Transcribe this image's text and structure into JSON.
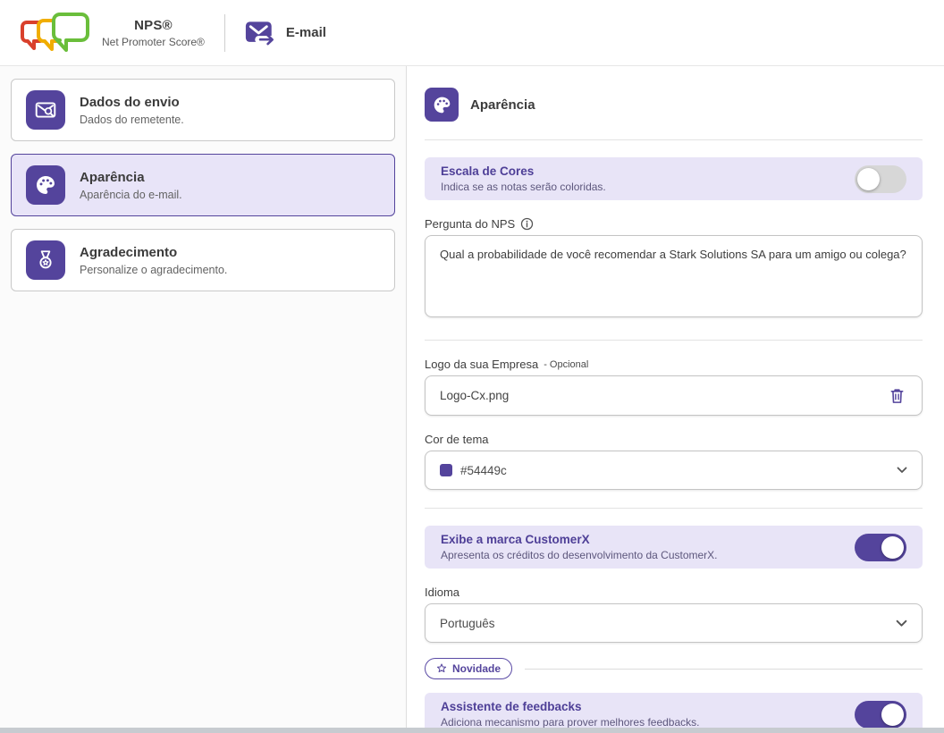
{
  "header": {
    "nps_title": "NPS®",
    "nps_subtitle": "Net Promoter Score®",
    "channel_label": "E-mail"
  },
  "sidebar": {
    "items": [
      {
        "title": "Dados do envio",
        "subtitle": "Dados do remetente.",
        "icon": "mail-search-icon",
        "active": false
      },
      {
        "title": "Aparência",
        "subtitle": "Aparência do e-mail.",
        "icon": "palette-icon",
        "active": true
      },
      {
        "title": "Agradecimento",
        "subtitle": "Personalize o agradecimento.",
        "icon": "medal-icon",
        "active": false
      }
    ]
  },
  "panel": {
    "title": "Aparência",
    "color_scale": {
      "title": "Escala de Cores",
      "subtitle": "Indica se as notas serão coloridas.",
      "enabled": false
    },
    "nps_question": {
      "label": "Pergunta do NPS",
      "value": "Qual a probabilidade de você recomendar a Stark Solutions SA para um amigo ou colega?"
    },
    "company_logo": {
      "label": "Logo da sua Empresa",
      "optional_label": "- Opcional",
      "value": "Logo-Cx.png"
    },
    "theme_color": {
      "label": "Cor de tema",
      "value": "#54449c",
      "swatch": "#54449c"
    },
    "brand": {
      "title": "Exibe a marca CustomerX",
      "subtitle": "Apresenta os créditos do desenvolvimento da CustomerX.",
      "enabled": true
    },
    "language": {
      "label": "Idioma",
      "value": "Português"
    },
    "novelty_badge": "Novidade",
    "assistant": {
      "title": "Assistente de feedbacks",
      "subtitle": "Adiciona mecanismo para prover melhores feedbacks.",
      "enabled": true
    }
  },
  "colors": {
    "primary": "#54449c",
    "row_background": "#e8e4f7",
    "logo_red": "#d9402c",
    "logo_yellow": "#f0ad00",
    "logo_green": "#6abe3b"
  }
}
